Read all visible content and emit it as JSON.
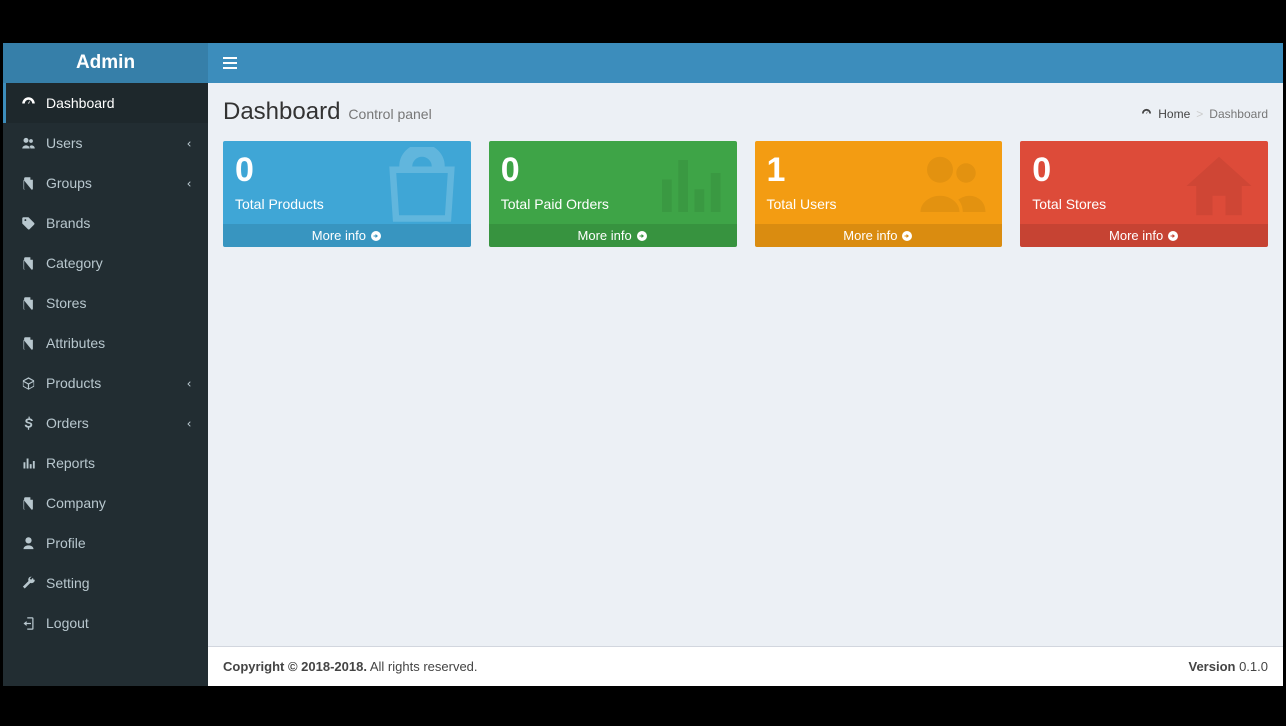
{
  "logo": "Admin",
  "sidebar": {
    "items": [
      {
        "label": "Dashboard",
        "icon": "dashboard",
        "active": true
      },
      {
        "label": "Users",
        "icon": "users",
        "expandable": true
      },
      {
        "label": "Groups",
        "icon": "files",
        "expandable": true
      },
      {
        "label": "Brands",
        "icon": "tag"
      },
      {
        "label": "Category",
        "icon": "files"
      },
      {
        "label": "Stores",
        "icon": "files"
      },
      {
        "label": "Attributes",
        "icon": "files"
      },
      {
        "label": "Products",
        "icon": "cube",
        "expandable": true
      },
      {
        "label": "Orders",
        "icon": "dollar",
        "expandable": true
      },
      {
        "label": "Reports",
        "icon": "bar"
      },
      {
        "label": "Company",
        "icon": "files"
      },
      {
        "label": "Profile",
        "icon": "user"
      },
      {
        "label": "Setting",
        "icon": "wrench"
      },
      {
        "label": "Logout",
        "icon": "logout"
      }
    ]
  },
  "header": {
    "title": "Dashboard",
    "subtitle": "Control panel"
  },
  "breadcrumb": {
    "home": "Home",
    "current": "Dashboard"
  },
  "cards": [
    {
      "value": "0",
      "label": "Total Products",
      "link": "More info",
      "color": "aqua",
      "icon": "bag"
    },
    {
      "value": "0",
      "label": "Total Paid Orders",
      "link": "More info",
      "color": "green",
      "icon": "bar"
    },
    {
      "value": "1",
      "label": "Total Users",
      "link": "More info",
      "color": "yellow",
      "icon": "users"
    },
    {
      "value": "0",
      "label": "Total Stores",
      "link": "More info",
      "color": "red",
      "icon": "home"
    }
  ],
  "footer": {
    "copyright_strong": "Copyright © 2018-2018.",
    "copyright_rest": " All rights reserved.",
    "version_label": "Version",
    "version_value": " 0.1.0"
  }
}
